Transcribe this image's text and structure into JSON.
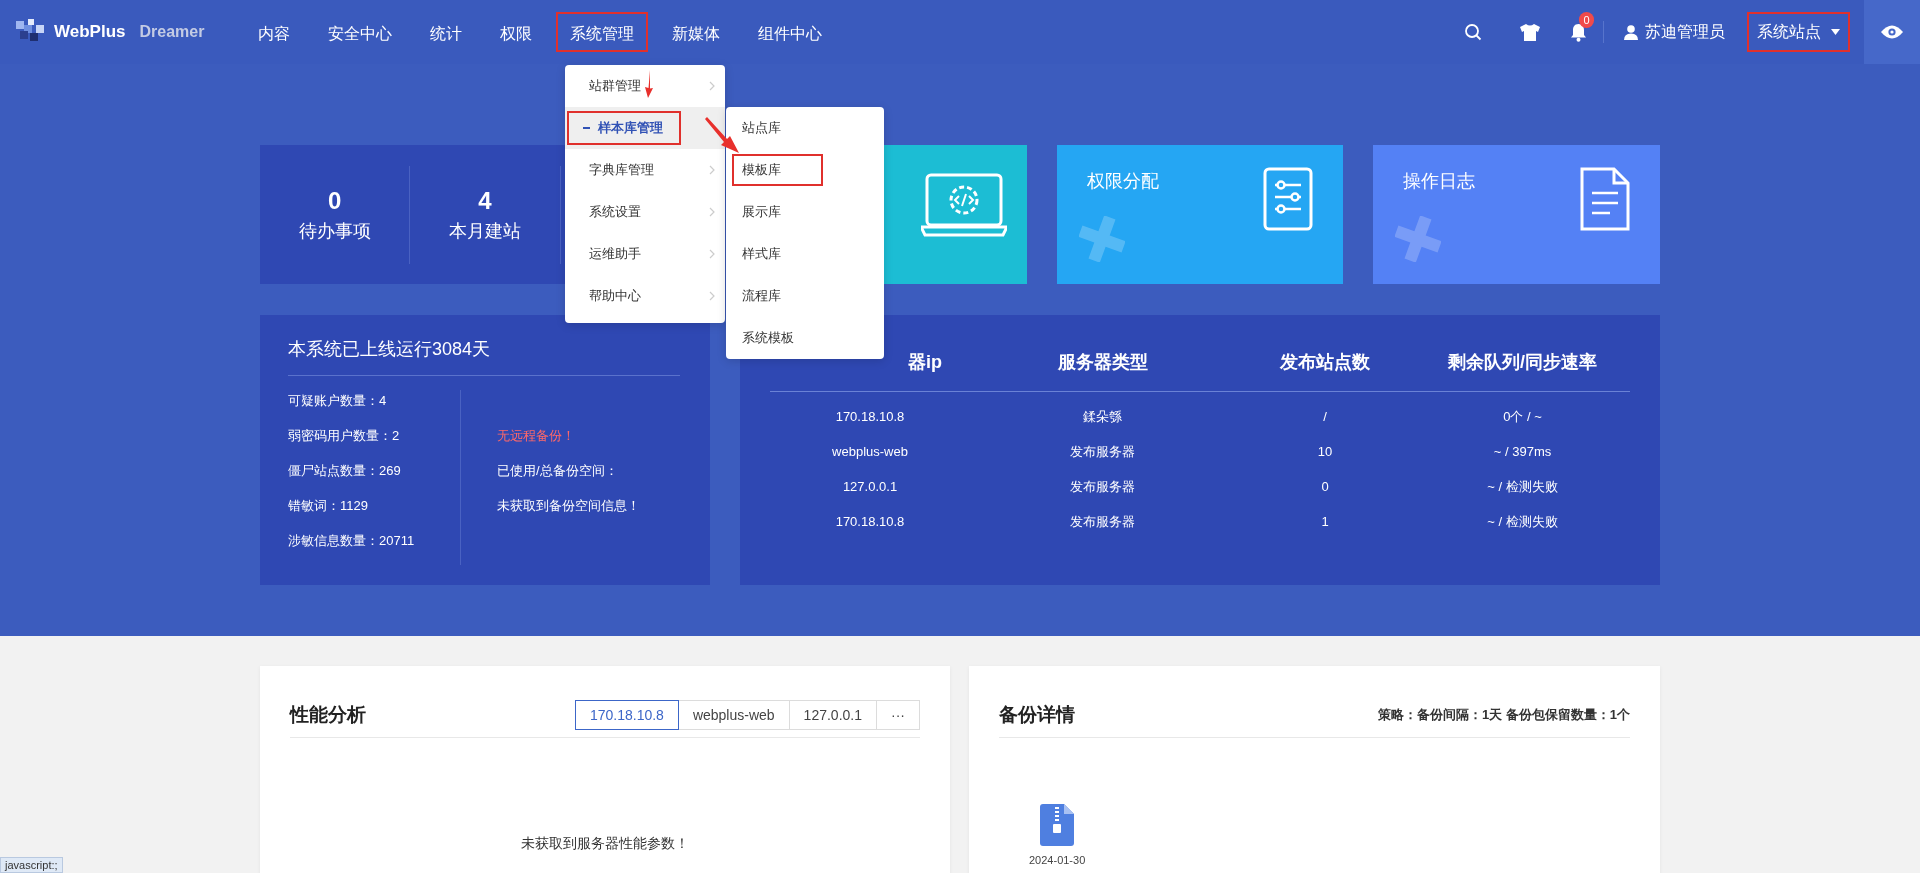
{
  "header": {
    "logo": {
      "name": "WebPlus",
      "suffix": "Dreamer"
    },
    "nav": [
      {
        "label": "内容",
        "marked": false
      },
      {
        "label": "安全中心",
        "marked": false
      },
      {
        "label": "统计",
        "marked": false
      },
      {
        "label": "权限",
        "marked": false
      },
      {
        "label": "系统管理",
        "marked": true
      },
      {
        "label": "新媒体",
        "marked": false
      },
      {
        "label": "组件中心",
        "marked": false
      }
    ],
    "notification_count": "0",
    "user": "苏迪管理员",
    "site_selector": {
      "label": "系统站点",
      "marked": true
    }
  },
  "dropdown": {
    "items": [
      {
        "label": "站群管理",
        "expanded": false,
        "marked": false
      },
      {
        "label": "样本库管理",
        "expanded": true,
        "marked": true
      },
      {
        "label": "字典库管理",
        "expanded": false,
        "marked": false
      },
      {
        "label": "系统设置",
        "expanded": false,
        "marked": false
      },
      {
        "label": "运维助手",
        "expanded": false,
        "marked": false
      },
      {
        "label": "帮助中心",
        "expanded": false,
        "marked": false
      }
    ],
    "submenu": [
      {
        "label": "站点库",
        "marked": false
      },
      {
        "label": "模板库",
        "marked": true
      },
      {
        "label": "展示库",
        "marked": false
      },
      {
        "label": "样式库",
        "marked": false
      },
      {
        "label": "流程库",
        "marked": false
      },
      {
        "label": "系统模板",
        "marked": false
      }
    ]
  },
  "stats": [
    {
      "value": "0",
      "label": "待办事项"
    },
    {
      "value": "4",
      "label": "本月建站"
    }
  ],
  "shortcuts": [
    {
      "kind": "code",
      "color": "#1cbdd4"
    },
    {
      "kind": "permissions",
      "title": "权限分配",
      "color": "#25a6f3"
    },
    {
      "kind": "log",
      "title": "操作日志",
      "color": "#5481f5"
    }
  ],
  "system_info": {
    "title": "本系统已上线运行3084天",
    "counts": [
      "可疑账户数量：4",
      "弱密码用户数量：2",
      "僵尸站点数量：269",
      "错敏词：1129",
      "涉敏信息数量：20711"
    ],
    "backup": [
      {
        "kind": "warning",
        "text": "无远程备份！"
      },
      {
        "kind": "text",
        "text": "已使用/总备份空间："
      },
      {
        "kind": "text",
        "text": "未获取到备份空间信息！"
      }
    ]
  },
  "servers": {
    "columns": [
      "器ip",
      "服务器类型",
      "发布站点数",
      "剩余队列/同步速率"
    ],
    "rows": [
      [
        "170.18.10.8",
        "鍒朵綔",
        "/",
        "0个 / ~"
      ],
      [
        "webplus-web",
        "发布服务器",
        "10",
        "~ / 397ms"
      ],
      [
        "127.0.0.1",
        "发布服务器",
        "0",
        "~ / 检测失败"
      ],
      [
        "170.18.10.8",
        "发布服务器",
        "1",
        "~ / 检测失败"
      ]
    ]
  },
  "performance": {
    "title": "性能分析",
    "tabs": [
      {
        "label": "170.18.10.8",
        "selected": true
      },
      {
        "label": "webplus-web",
        "selected": false
      },
      {
        "label": "127.0.0.1",
        "selected": false
      },
      {
        "label": "···",
        "selected": false
      }
    ],
    "message": "未获取到服务器性能参数！"
  },
  "backup": {
    "title": "备份详情",
    "policy": "策略：备份间隔：1天 备份包保留数量：1个",
    "files": [
      {
        "date": "2024-01-30"
      }
    ]
  },
  "status_link": "javascript:;"
}
